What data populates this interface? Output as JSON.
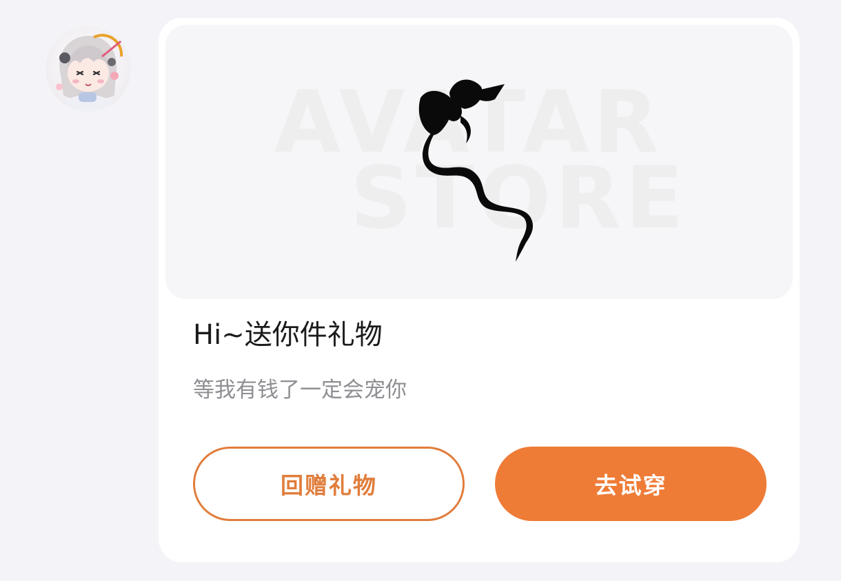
{
  "sender": {
    "avatar_icon": "anime-girl-avatar"
  },
  "gift_card": {
    "banner": {
      "watermark_line1": "AVATAR",
      "watermark_line2": "STORE",
      "item_icon": "black-ribbon-hair-accessory"
    },
    "title": "Hi~送你件礼物",
    "message": "等我有钱了一定会宠你",
    "buttons": {
      "return_gift": "回赠礼物",
      "try_on": "去试穿"
    }
  },
  "colors": {
    "accent": "#ee7c37",
    "outline": "#e07d3c",
    "page_background": "#f4f4f8",
    "card_background": "#ffffff"
  }
}
